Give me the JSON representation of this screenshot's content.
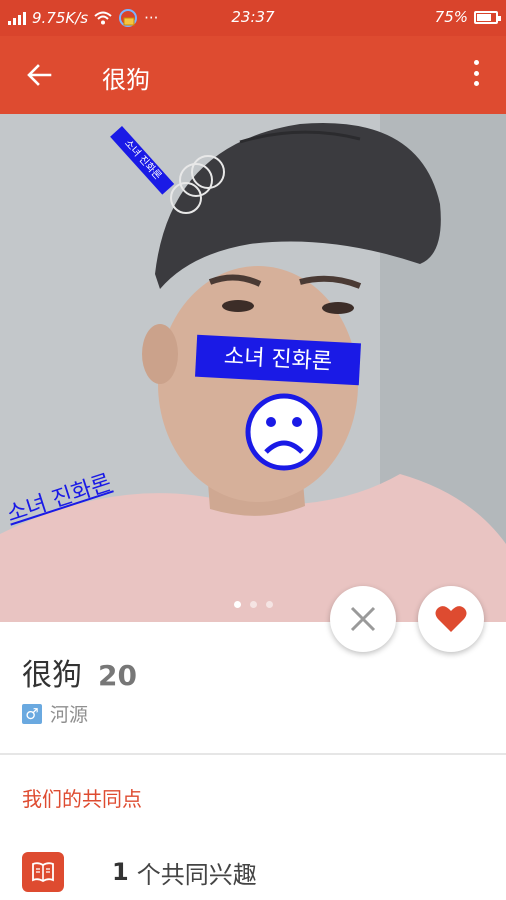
{
  "status_bar": {
    "net_speed": "9.75K/s",
    "time": "23:37",
    "battery": "75%",
    "battery_level": 0.75
  },
  "app_bar": {
    "title": "很狗",
    "back_icon": "arrow-left-icon",
    "menu_icon": "more-vert-icon"
  },
  "photo": {
    "stickers": [
      "소녀 진화론",
      "소녀 진화론",
      "소녀 진화론"
    ],
    "face_icon": "sad-face-icon",
    "page_count": 3,
    "active_page": 1
  },
  "actions": {
    "dislike_icon": "close-icon",
    "like_icon": "heart-icon"
  },
  "profile": {
    "name": "很狗",
    "age": "20",
    "gender_icon": "male-icon",
    "location": "河源"
  },
  "common": {
    "title": "我们的共同点",
    "interest_icon": "book-icon",
    "interest_count": "1",
    "interest_label": "个共同兴趣"
  },
  "colors": {
    "brand": "#de4b30",
    "sticker_blue": "#1a1ae6",
    "gender_blue": "#6aa9e0"
  }
}
